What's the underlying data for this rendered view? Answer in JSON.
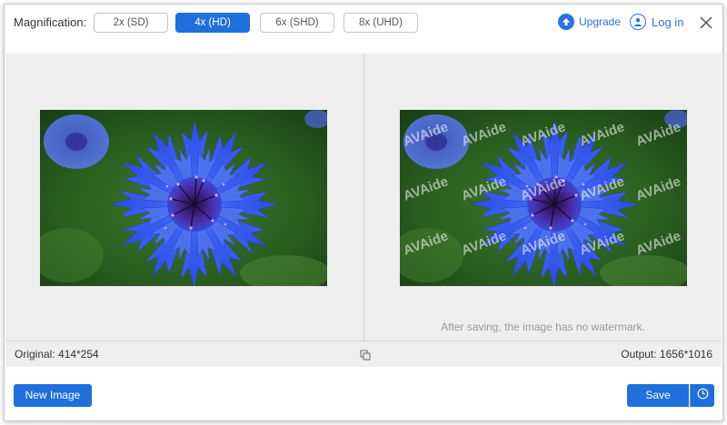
{
  "header": {
    "magnification_label": "Magnification:",
    "options": [
      {
        "label": "2x (SD)",
        "active": false
      },
      {
        "label": "4x (HD)",
        "active": true
      },
      {
        "label": "6x (SHD)",
        "active": false
      },
      {
        "label": "8x (UHD)",
        "active": false
      }
    ],
    "upgrade_label": "Upgrade",
    "login_label": "Log in",
    "close_icon": "close-icon"
  },
  "preview": {
    "left_image": "blue cornflower",
    "right_image": "blue cornflower with watermark",
    "watermark_text": "AVAide",
    "note": "After saving, the image has no watermark."
  },
  "info": {
    "original": "Original: 414*254",
    "output": "Output: 1656*1016",
    "compare_icon": "compare-icon"
  },
  "footer": {
    "new_image_label": "New Image",
    "save_label": "Save",
    "history_icon": "clock-icon"
  },
  "colors": {
    "accent": "#1f6fdc",
    "link": "#2a73de",
    "panel_bg": "#eeeeee"
  }
}
